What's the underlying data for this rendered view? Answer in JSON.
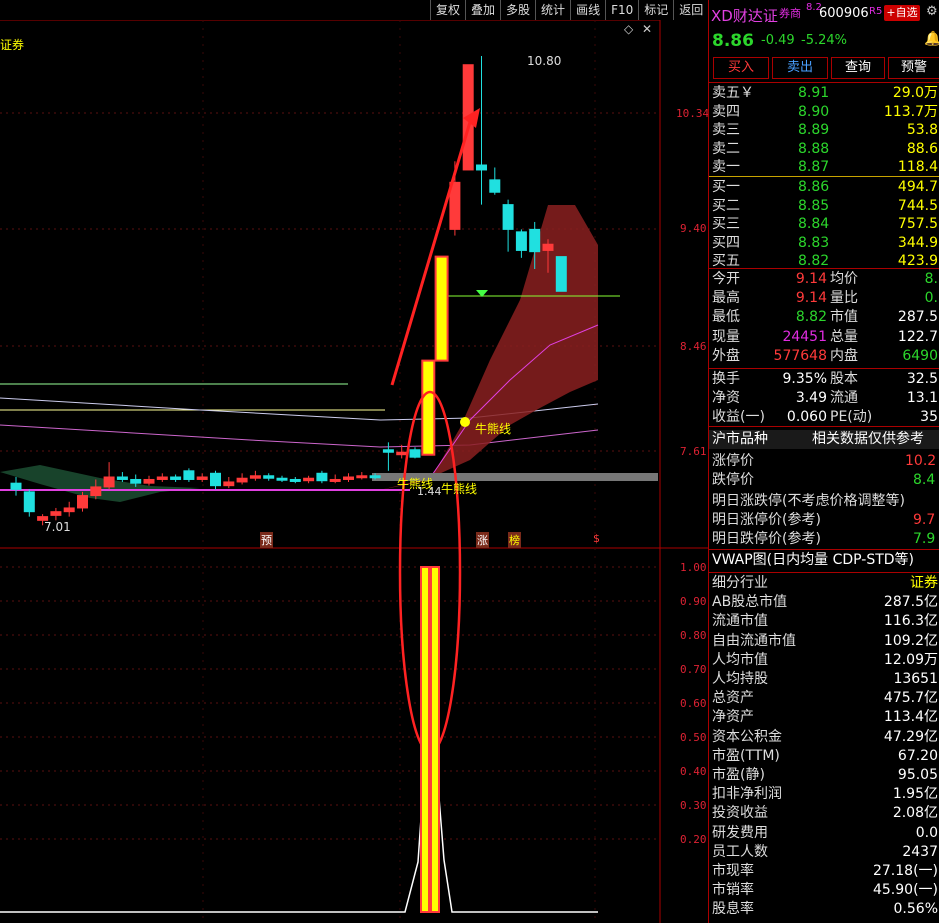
{
  "toolbar": {
    "items": [
      "复权",
      "叠加",
      "多股",
      "统计",
      "画线",
      "F10",
      "标记",
      "返回"
    ]
  },
  "chart": {
    "title_fragment": "证券",
    "high_label": "10.80",
    "low_label": "7.01",
    "price_axis": [
      "10.34",
      "9.40",
      "8.46",
      "7.61"
    ],
    "indicator_axis": [
      "1.00",
      "0.90",
      "0.80",
      "0.70",
      "0.60",
      "0.50",
      "0.40",
      "0.30",
      "0.20"
    ],
    "bull_line_label": "牛熊线",
    "bull_line_label2": "牛熊线",
    "price_tag": "1.44",
    "markers": [
      "预",
      "涨",
      "榜",
      "$"
    ]
  },
  "header": {
    "name": "XD财达证",
    "tag": "券商",
    "tag_value": "8.2",
    "code": "600906",
    "r_label": "R5",
    "watch_button": "+自选",
    "price": "8.86",
    "change": "-0.49",
    "change_pct": "-5.24%"
  },
  "actions": {
    "buy": "买入",
    "sell": "卖出",
    "query": "查询",
    "alert": "预警"
  },
  "orderbook": {
    "asks": [
      {
        "label": "卖五￥",
        "price": "8.91",
        "vol": "29.0万"
      },
      {
        "label": "卖四",
        "price": "8.90",
        "vol": "113.7万"
      },
      {
        "label": "卖三",
        "price": "8.89",
        "vol": "53.8"
      },
      {
        "label": "卖二",
        "price": "8.88",
        "vol": "88.6"
      },
      {
        "label": "卖一",
        "price": "8.87",
        "vol": "118.4"
      }
    ],
    "bids": [
      {
        "label": "买一",
        "price": "8.86",
        "vol": "494.7"
      },
      {
        "label": "买二",
        "price": "8.85",
        "vol": "744.5"
      },
      {
        "label": "买三",
        "price": "8.84",
        "vol": "757.5"
      },
      {
        "label": "买四",
        "price": "8.83",
        "vol": "344.9"
      },
      {
        "label": "买五",
        "price": "8.82",
        "vol": "423.9"
      }
    ]
  },
  "quote": {
    "open_l": "今开",
    "open": "9.14",
    "avg_l": "均价",
    "avg": "8.",
    "high_l": "最高",
    "high": "9.14",
    "vr_l": "量比",
    "vr": "0.",
    "low_l": "最低",
    "low": "8.82",
    "mcap_l": "市值",
    "mcap": "287.5",
    "cur_l": "现量",
    "cur": "24451",
    "tot_l": "总量",
    "tot": "122.7",
    "out_l": "外盘",
    "out": "577648",
    "in_l": "内盘",
    "inn": "6490",
    "turn_l": "换手",
    "turn": "9.35%",
    "cap_l": "股本",
    "cap": "32.5",
    "nav_l": "净资",
    "nav": "3.49",
    "flow_l": "流通",
    "flow": "13.1",
    "eps_l": "收益(一)",
    "eps": "0.060",
    "pe_l": "PE(动)",
    "pe": "35"
  },
  "market": {
    "title": "沪市品种",
    "note": "相关数据仅供参考",
    "limit_up_l": "涨停价",
    "limit_up": "10.2",
    "limit_down_l": "跌停价",
    "limit_down": "8.4",
    "next_title": "明日涨跌停(不考虑价格调整等)",
    "next_up_l": "明日涨停价(参考)",
    "next_up": "9.7",
    "next_down_l": "明日跌停价(参考)",
    "next_down": "7.9"
  },
  "vwap_title": "VWAP图(日内均量 CDP-STD等)",
  "fundamentals": [
    {
      "label": "细分行业",
      "value": "证券"
    },
    {
      "label": "AB股总市值",
      "value": "287.5亿"
    },
    {
      "label": "流通市值",
      "value": "116.3亿"
    },
    {
      "label": "自由流通市值",
      "value": "109.2亿"
    },
    {
      "label": "人均市值",
      "value": "12.09万"
    },
    {
      "label": "人均持股",
      "value": "13651"
    },
    {
      "label": "总资产",
      "value": "475.7亿"
    },
    {
      "label": "净资产",
      "value": "113.4亿"
    },
    {
      "label": "资本公积金",
      "value": "47.29亿"
    },
    {
      "label": "市盈(TTM)",
      "value": "67.20"
    },
    {
      "label": "市盈(静)",
      "value": "95.05"
    },
    {
      "label": "扣非净利润",
      "value": "1.95亿"
    },
    {
      "label": "投资收益",
      "value": "2.08亿"
    },
    {
      "label": "研发费用",
      "value": "0.0"
    },
    {
      "label": "员工人数",
      "value": "2437"
    },
    {
      "label": "市现率",
      "value": "27.18(一)"
    },
    {
      "label": "市销率",
      "value": "45.90(一)"
    },
    {
      "label": "股息率",
      "value": "0.56%"
    }
  ],
  "chart_data": {
    "type": "candlestick",
    "price_axis_ticks": [
      10.34,
      9.4,
      8.46,
      7.61
    ],
    "indicator_axis_ticks": [
      1.0,
      0.9,
      0.8,
      0.7,
      0.6,
      0.5,
      0.4,
      0.3,
      0.2
    ],
    "high": 10.8,
    "low": 7.01,
    "reference_line": 9.14,
    "candles": [
      {
        "o": 7.35,
        "c": 7.3,
        "h": 7.4,
        "l": 7.25
      },
      {
        "o": 7.28,
        "c": 7.12,
        "h": 7.3,
        "l": 7.08
      },
      {
        "o": 7.05,
        "c": 7.08,
        "h": 7.1,
        "l": 7.01
      },
      {
        "o": 7.09,
        "c": 7.12,
        "h": 7.15,
        "l": 7.05
      },
      {
        "o": 7.12,
        "c": 7.15,
        "h": 7.2,
        "l": 7.08
      },
      {
        "o": 7.15,
        "c": 7.25,
        "h": 7.28,
        "l": 7.12
      },
      {
        "o": 7.25,
        "c": 7.32,
        "h": 7.38,
        "l": 7.22
      },
      {
        "o": 7.32,
        "c": 7.4,
        "h": 7.52,
        "l": 7.3
      },
      {
        "o": 7.4,
        "c": 7.38,
        "h": 7.44,
        "l": 7.36
      },
      {
        "o": 7.38,
        "c": 7.35,
        "h": 7.42,
        "l": 7.32
      },
      {
        "o": 7.35,
        "c": 7.38,
        "h": 7.41,
        "l": 7.33
      },
      {
        "o": 7.38,
        "c": 7.4,
        "h": 7.43,
        "l": 7.36
      },
      {
        "o": 7.4,
        "c": 7.38,
        "h": 7.42,
        "l": 7.36
      },
      {
        "o": 7.45,
        "c": 7.38,
        "h": 7.47,
        "l": 7.36
      },
      {
        "o": 7.38,
        "c": 7.4,
        "h": 7.43,
        "l": 7.36
      },
      {
        "o": 7.43,
        "c": 7.33,
        "h": 7.45,
        "l": 7.3
      },
      {
        "o": 7.33,
        "c": 7.36,
        "h": 7.4,
        "l": 7.31
      },
      {
        "o": 7.36,
        "c": 7.39,
        "h": 7.43,
        "l": 7.34
      },
      {
        "o": 7.39,
        "c": 7.41,
        "h": 7.45,
        "l": 7.37
      },
      {
        "o": 7.41,
        "c": 7.39,
        "h": 7.43,
        "l": 7.37
      },
      {
        "o": 7.39,
        "c": 7.38,
        "h": 7.41,
        "l": 7.36
      },
      {
        "o": 7.38,
        "c": 7.37,
        "h": 7.4,
        "l": 7.35
      },
      {
        "o": 7.37,
        "c": 7.39,
        "h": 7.41,
        "l": 7.35
      },
      {
        "o": 7.43,
        "c": 7.37,
        "h": 7.45,
        "l": 7.35
      },
      {
        "o": 7.37,
        "c": 7.38,
        "h": 7.42,
        "l": 7.35
      },
      {
        "o": 7.38,
        "c": 7.4,
        "h": 7.43,
        "l": 7.36
      },
      {
        "o": 7.4,
        "c": 7.41,
        "h": 7.44,
        "l": 7.38
      },
      {
        "o": 7.41,
        "c": 7.4,
        "h": 7.43,
        "l": 7.38
      },
      {
        "o": 7.62,
        "c": 7.6,
        "h": 7.68,
        "l": 7.45
      },
      {
        "o": 7.58,
        "c": 7.6,
        "h": 7.66,
        "l": 7.55
      },
      {
        "o": 7.62,
        "c": 7.56,
        "h": 7.64,
        "l": 7.55
      },
      {
        "o": 7.58,
        "c": 8.34,
        "h": 8.34,
        "l": 7.58
      },
      {
        "o": 8.34,
        "c": 9.18,
        "h": 9.18,
        "l": 8.34
      },
      {
        "o": 9.4,
        "c": 9.78,
        "h": 9.95,
        "l": 9.35
      },
      {
        "o": 9.88,
        "c": 10.73,
        "h": 10.73,
        "l": 9.88
      },
      {
        "o": 9.92,
        "c": 9.88,
        "h": 10.8,
        "l": 9.6
      },
      {
        "o": 9.8,
        "c": 9.7,
        "h": 9.9,
        "l": 9.68
      },
      {
        "o": 9.6,
        "c": 9.4,
        "h": 9.64,
        "l": 9.22
      },
      {
        "o": 9.38,
        "c": 9.23,
        "h": 9.4,
        "l": 9.17
      },
      {
        "o": 9.4,
        "c": 9.22,
        "h": 9.46,
        "l": 9.08
      },
      {
        "o": 9.23,
        "c": 9.28,
        "h": 9.32,
        "l": 9.05
      },
      {
        "o": 9.18,
        "c": 8.9,
        "h": 9.18,
        "l": 8.9
      }
    ],
    "indicator": {
      "bars_at_candle": [
        31,
        32
      ],
      "bar_value": 1.0
    }
  }
}
